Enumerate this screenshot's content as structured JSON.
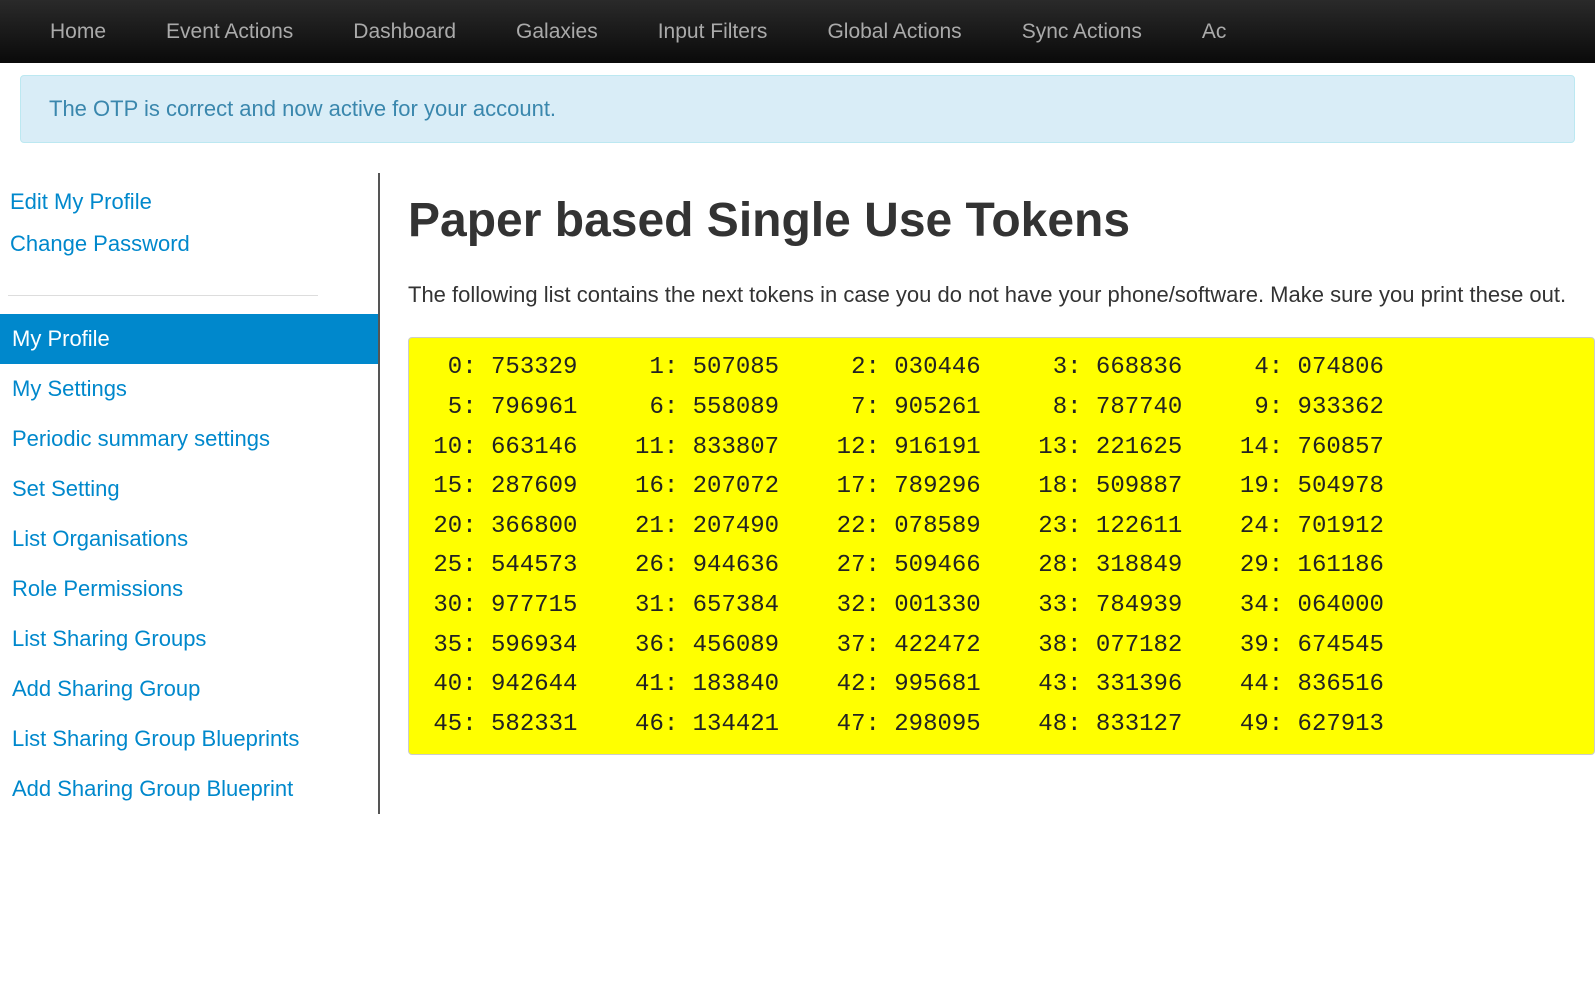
{
  "topnav": {
    "items": [
      "Home",
      "Event Actions",
      "Dashboard",
      "Galaxies",
      "Input Filters",
      "Global Actions",
      "Sync Actions",
      "Ac"
    ]
  },
  "alert": {
    "message": "The OTP is correct and now active for your account."
  },
  "sidebar": {
    "top": [
      "Edit My Profile",
      "Change Password"
    ],
    "items": [
      {
        "label": "My Profile",
        "active": true
      },
      {
        "label": "My Settings",
        "active": false
      },
      {
        "label": "Periodic summary settings",
        "active": false
      },
      {
        "label": "Set Setting",
        "active": false
      },
      {
        "label": "List Organisations",
        "active": false
      },
      {
        "label": "Role Permissions",
        "active": false
      },
      {
        "label": "List Sharing Groups",
        "active": false
      },
      {
        "label": "Add Sharing Group",
        "active": false
      },
      {
        "label": "List Sharing Group Blueprints",
        "active": false
      },
      {
        "label": "Add Sharing Group Blueprint",
        "active": false
      }
    ]
  },
  "main": {
    "title": "Paper based Single Use Tokens",
    "description": "The following list contains the next tokens in case you do not have your phone/software. Make sure you print these out."
  },
  "tokens": [
    {
      "i": 0,
      "v": "753329"
    },
    {
      "i": 1,
      "v": "507085"
    },
    {
      "i": 2,
      "v": "030446"
    },
    {
      "i": 3,
      "v": "668836"
    },
    {
      "i": 4,
      "v": "074806"
    },
    {
      "i": 5,
      "v": "796961"
    },
    {
      "i": 6,
      "v": "558089"
    },
    {
      "i": 7,
      "v": "905261"
    },
    {
      "i": 8,
      "v": "787740"
    },
    {
      "i": 9,
      "v": "933362"
    },
    {
      "i": 10,
      "v": "663146"
    },
    {
      "i": 11,
      "v": "833807"
    },
    {
      "i": 12,
      "v": "916191"
    },
    {
      "i": 13,
      "v": "221625"
    },
    {
      "i": 14,
      "v": "760857"
    },
    {
      "i": 15,
      "v": "287609"
    },
    {
      "i": 16,
      "v": "207072"
    },
    {
      "i": 17,
      "v": "789296"
    },
    {
      "i": 18,
      "v": "509887"
    },
    {
      "i": 19,
      "v": "504978"
    },
    {
      "i": 20,
      "v": "366800"
    },
    {
      "i": 21,
      "v": "207490"
    },
    {
      "i": 22,
      "v": "078589"
    },
    {
      "i": 23,
      "v": "122611"
    },
    {
      "i": 24,
      "v": "701912"
    },
    {
      "i": 25,
      "v": "544573"
    },
    {
      "i": 26,
      "v": "944636"
    },
    {
      "i": 27,
      "v": "509466"
    },
    {
      "i": 28,
      "v": "318849"
    },
    {
      "i": 29,
      "v": "161186"
    },
    {
      "i": 30,
      "v": "977715"
    },
    {
      "i": 31,
      "v": "657384"
    },
    {
      "i": 32,
      "v": "001330"
    },
    {
      "i": 33,
      "v": "784939"
    },
    {
      "i": 34,
      "v": "064000"
    },
    {
      "i": 35,
      "v": "596934"
    },
    {
      "i": 36,
      "v": "456089"
    },
    {
      "i": 37,
      "v": "422472"
    },
    {
      "i": 38,
      "v": "077182"
    },
    {
      "i": 39,
      "v": "674545"
    },
    {
      "i": 40,
      "v": "942644"
    },
    {
      "i": 41,
      "v": "183840"
    },
    {
      "i": 42,
      "v": "995681"
    },
    {
      "i": 43,
      "v": "331396"
    },
    {
      "i": 44,
      "v": "836516"
    },
    {
      "i": 45,
      "v": "582331"
    },
    {
      "i": 46,
      "v": "134421"
    },
    {
      "i": 47,
      "v": "298095"
    },
    {
      "i": 48,
      "v": "833127"
    },
    {
      "i": 49,
      "v": "627913"
    }
  ]
}
